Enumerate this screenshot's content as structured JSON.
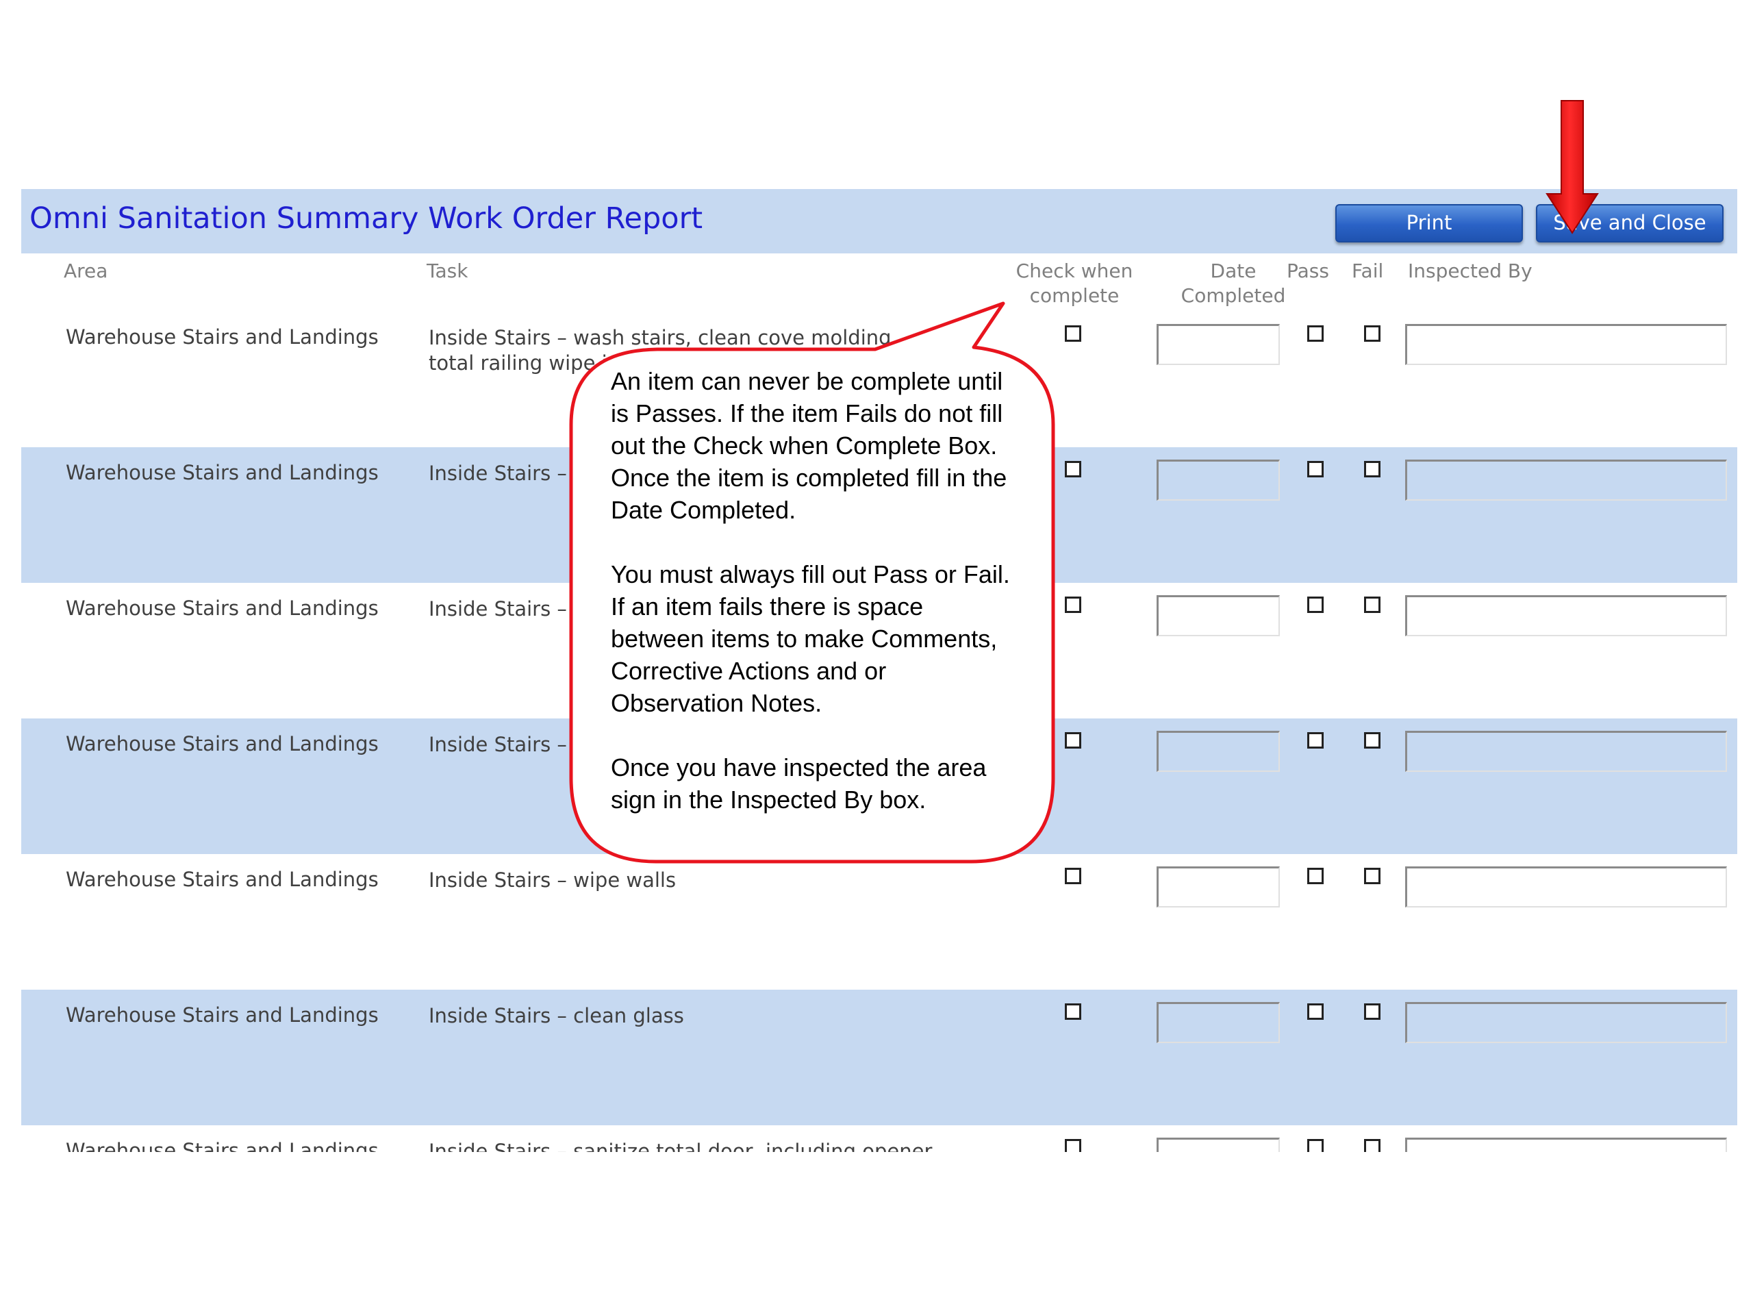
{
  "header": {
    "title": "Omni Sanitation Summary Work Order Report",
    "print_label": "Print",
    "save_close_label": "Save and Close"
  },
  "columns": {
    "area": "Area",
    "task": "Task",
    "check_when_complete": "Check when complete",
    "date_completed": "Date Completed",
    "pass": "Pass",
    "fail": "Fail",
    "inspected_by": "Inspected By"
  },
  "rows": [
    {
      "area": "Warehouse Stairs and Landings",
      "task": "Inside Stairs – wash stairs, clean cove molding, total railing wipe including opener"
    },
    {
      "area": "Warehouse Stairs and Landings",
      "task": "Inside Stairs –"
    },
    {
      "area": "Warehouse Stairs and Landings",
      "task": "Inside Stairs –"
    },
    {
      "area": "Warehouse Stairs and Landings",
      "task": "Inside Stairs –"
    },
    {
      "area": "Warehouse Stairs and Landings",
      "task": "Inside Stairs –  wipe walls"
    },
    {
      "area": "Warehouse Stairs and Landings",
      "task": "Inside Stairs –  clean glass"
    },
    {
      "area": "Warehouse Stairs and Landings",
      "task": "Inside Stairs –  sanitize total door, including opener"
    }
  ],
  "callout": {
    "paragraph_1": "An item can never be complete until is Passes. If the item Fails do not fill out the Check when Complete Box. Once the item is completed fill in the Date Completed.",
    "paragraph_2": "You must always fill out Pass or Fail. If an item fails there is space between items to make Comments, Corrective Actions and or Observation Notes.",
    "paragraph_3": "Once you have inspected the area sign in the Inspected By box."
  },
  "colors": {
    "band": "#c6d9f1",
    "title": "#1f1fd0",
    "button": "#2a62c6",
    "callout_border": "#e8141e",
    "arrow": "#e8141e"
  }
}
